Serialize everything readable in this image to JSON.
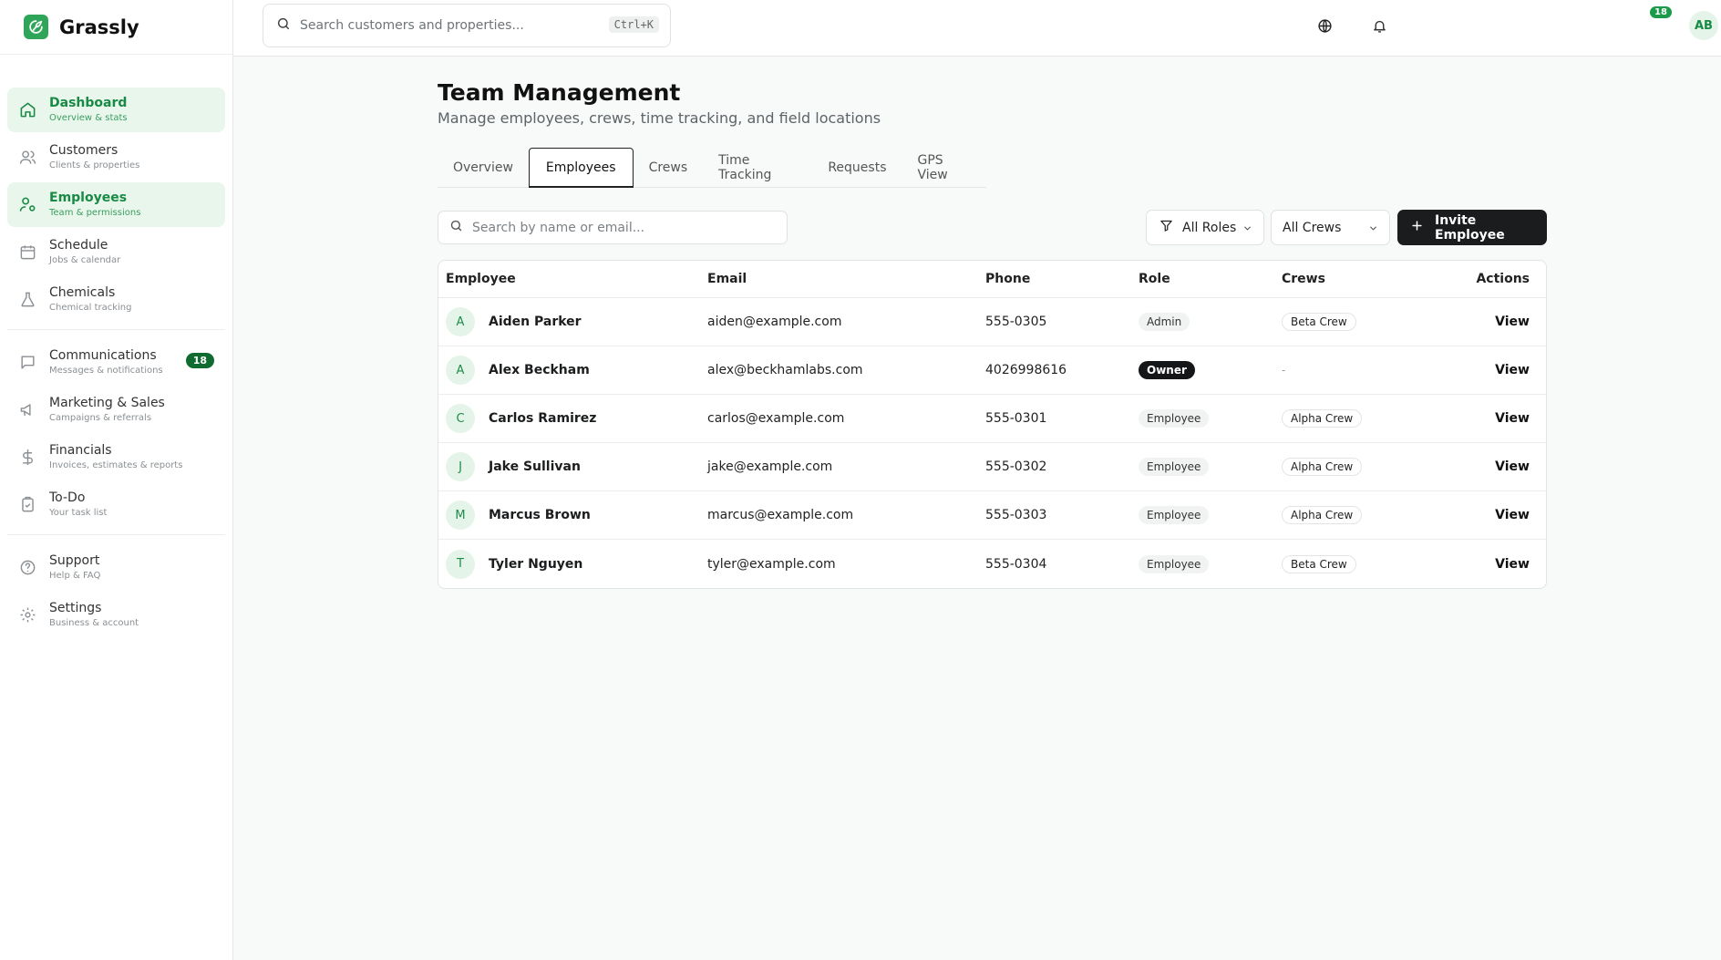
{
  "app": {
    "name": "Grassly"
  },
  "topbar": {
    "search_placeholder": "Search customers and properties...",
    "search_shortcut": "Ctrl+K",
    "notification_count": "18",
    "user_initials": "AB"
  },
  "sidebar": {
    "items": [
      {
        "label": "Dashboard",
        "sub": "Overview & stats",
        "icon": "home-icon",
        "active": true
      },
      {
        "label": "Customers",
        "sub": "Clients & properties",
        "icon": "users-icon"
      },
      {
        "label": "Employees",
        "sub": "Team & permissions",
        "icon": "user-cog-icon",
        "active": true
      },
      {
        "label": "Schedule",
        "sub": "Jobs & calendar",
        "icon": "calendar-icon"
      },
      {
        "label": "Chemicals",
        "sub": "Chemical tracking",
        "icon": "flask-icon"
      },
      {
        "label": "Communications",
        "sub": "Messages & notifications",
        "icon": "message-icon",
        "badge": "18"
      },
      {
        "label": "Marketing & Sales",
        "sub": "Campaigns & referrals",
        "icon": "megaphone-icon"
      },
      {
        "label": "Financials",
        "sub": "Invoices, estimates & reports",
        "icon": "dollar-icon"
      },
      {
        "label": "To-Do",
        "sub": "Your task list",
        "icon": "clipboard-check-icon"
      },
      {
        "label": "Support",
        "sub": "Help & FAQ",
        "icon": "help-circle-icon"
      },
      {
        "label": "Settings",
        "sub": "Business & account",
        "icon": "gear-icon"
      }
    ]
  },
  "page": {
    "title": "Team Management",
    "subtitle": "Manage employees, crews, time tracking, and field locations"
  },
  "tabs": [
    "Overview",
    "Employees",
    "Crews",
    "Time Tracking",
    "Requests",
    "GPS View"
  ],
  "active_tab": "Employees",
  "filters": {
    "search_placeholder": "Search by name or email...",
    "roles_value": "All Roles",
    "crews_value": "All Crews",
    "invite_label": "Invite Employee"
  },
  "table": {
    "headers": [
      "Employee",
      "Email",
      "Phone",
      "Role",
      "Crews",
      "Actions"
    ],
    "rows": [
      {
        "initial": "A",
        "name": "Aiden Parker",
        "email": "aiden@example.com",
        "phone": "555-0305",
        "role": "Admin",
        "crew": "Beta Crew",
        "action": "View"
      },
      {
        "initial": "A",
        "name": "Alex Beckham",
        "email": "alex@beckhamlabs.com",
        "phone": "4026998616",
        "role": "Owner",
        "crew": "-",
        "action": "View"
      },
      {
        "initial": "C",
        "name": "Carlos Ramirez",
        "email": "carlos@example.com",
        "phone": "555-0301",
        "role": "Employee",
        "crew": "Alpha Crew",
        "action": "View"
      },
      {
        "initial": "J",
        "name": "Jake Sullivan",
        "email": "jake@example.com",
        "phone": "555-0302",
        "role": "Employee",
        "crew": "Alpha Crew",
        "action": "View"
      },
      {
        "initial": "M",
        "name": "Marcus Brown",
        "email": "marcus@example.com",
        "phone": "555-0303",
        "role": "Employee",
        "crew": "Alpha Crew",
        "action": "View"
      },
      {
        "initial": "T",
        "name": "Tyler Nguyen",
        "email": "tyler@example.com",
        "phone": "555-0304",
        "role": "Employee",
        "crew": "Beta Crew",
        "action": "View"
      }
    ]
  },
  "colors": {
    "brand": "#2fa55a",
    "active_bg": "#e8f6ec",
    "badge_dark": "#0f6b2f",
    "button_dark": "#1a1c1d"
  }
}
